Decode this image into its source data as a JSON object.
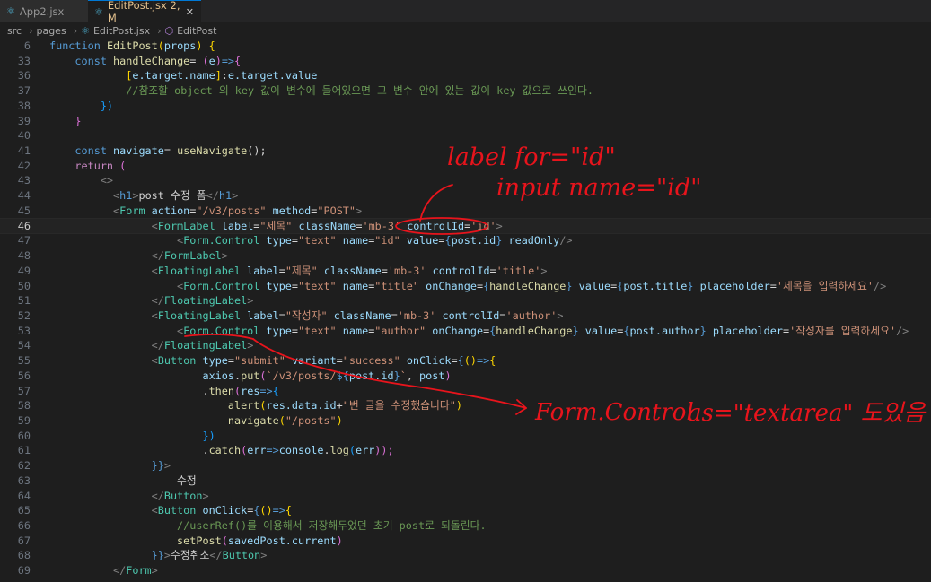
{
  "tabs": [
    {
      "label": "App2.jsx",
      "icon": "react-icon"
    },
    {
      "label": "EditPost.jsx 2, M",
      "icon": "react-icon",
      "active": true
    }
  ],
  "breadcrumb": [
    "src",
    "pages",
    "EditPost.jsx",
    "EditPost"
  ],
  "code_lines": [
    {
      "n": "6"
    },
    {
      "n": "33"
    },
    {
      "n": "36"
    },
    {
      "n": "37"
    },
    {
      "n": "38"
    },
    {
      "n": "39"
    },
    {
      "n": "40"
    },
    {
      "n": "41"
    },
    {
      "n": "42"
    },
    {
      "n": "43"
    },
    {
      "n": "44"
    },
    {
      "n": "45"
    },
    {
      "n": "46"
    },
    {
      "n": "47"
    },
    {
      "n": "48"
    },
    {
      "n": "49"
    },
    {
      "n": "50"
    },
    {
      "n": "51"
    },
    {
      "n": "52"
    },
    {
      "n": "53"
    },
    {
      "n": "54"
    },
    {
      "n": "55"
    },
    {
      "n": "56"
    },
    {
      "n": "57"
    },
    {
      "n": "58"
    },
    {
      "n": "59"
    },
    {
      "n": "60"
    },
    {
      "n": "61"
    },
    {
      "n": "62"
    },
    {
      "n": "63"
    },
    {
      "n": "64"
    },
    {
      "n": "65"
    },
    {
      "n": "66"
    },
    {
      "n": "67"
    },
    {
      "n": "68"
    },
    {
      "n": "69"
    }
  ],
  "code": {
    "l6": [
      "function",
      "EditPost",
      "(",
      "props",
      ")",
      "{"
    ],
    "l33": [
      "const",
      "handleChange",
      "=",
      "(",
      "e",
      ")",
      "=>",
      "{"
    ],
    "l36": [
      "[",
      "e.target.name",
      "]",
      ":",
      "e.target.value"
    ],
    "l37": "//참조할 object 의 key 값이 변수에 들어있으면 그 변수 안에 있는 값이 key 값으로 쓰인다.",
    "l38": "})",
    "l39": "}",
    "l41": [
      "const",
      "navigate",
      "=",
      "useNavigate",
      "();"
    ],
    "l42": [
      "return",
      "("
    ],
    "l43": "<>",
    "l44": [
      "<",
      "h1",
      ">",
      "post 수정 폼",
      "</",
      "h1",
      ">"
    ],
    "l45": [
      "<",
      "Form",
      "action",
      "=",
      "\"/v3/posts\"",
      "method",
      "=",
      "\"POST\"",
      ">"
    ],
    "l46": [
      "<",
      "FormLabel",
      "label",
      "=",
      "\"제목\"",
      "className",
      "=",
      "'mb-3'",
      "controlId",
      "=",
      "'id'",
      ">"
    ],
    "l47": [
      "<",
      "Form.Control",
      "type",
      "=",
      "\"text\"",
      "name",
      "=",
      "\"id\"",
      "value",
      "=",
      "{",
      "post.id",
      "}",
      "readOnly",
      "/>"
    ],
    "l48": [
      "</",
      "FormLabel",
      ">"
    ],
    "l49": [
      "<",
      "FloatingLabel",
      "label",
      "=",
      "\"제목\"",
      "className",
      "=",
      "'mb-3'",
      "controlId",
      "=",
      "'title'",
      ">"
    ],
    "l50": [
      "<",
      "Form.Control",
      "type",
      "=",
      "\"text\"",
      "name",
      "=",
      "\"title\"",
      "onChange",
      "=",
      "{",
      "handleChange",
      "}",
      "value",
      "=",
      "{",
      "post.title",
      "}",
      "placeholder",
      "=",
      "'제목을 입력하세요'",
      "/>"
    ],
    "l51": [
      "</",
      "FloatingLabel",
      ">"
    ],
    "l52": [
      "<",
      "FloatingLabel",
      "label",
      "=",
      "\"작성자\"",
      "className",
      "=",
      "'mb-3'",
      "controlId",
      "=",
      "'author'",
      ">"
    ],
    "l53": [
      "<",
      "Form.Control",
      "type",
      "=",
      "\"text\"",
      "name",
      "=",
      "\"author\"",
      "onChange",
      "=",
      "{",
      "handleChange",
      "}",
      "value",
      "=",
      "{",
      "post.author",
      "}",
      "placeholder",
      "=",
      "'작성자를 입력하세요'",
      "/>"
    ],
    "l54": [
      "</",
      "FloatingLabel",
      ">"
    ],
    "l55": [
      "<",
      "Button",
      "type",
      "=",
      "\"submit\"",
      "variant",
      "=",
      "\"success\"",
      "onClick",
      "=",
      "{",
      "()",
      "=>",
      "{"
    ],
    "l56": [
      "axios",
      ".",
      "put",
      "(",
      "`/v3/posts/",
      "${",
      "post.id",
      "}",
      "`",
      ", ",
      "post",
      ")"
    ],
    "l57": [
      ".",
      "then",
      "(",
      "res",
      "=>",
      "{"
    ],
    "l58": [
      "alert",
      "(",
      "res.data.id",
      "+",
      "\"번 글을 수정했습니다\"",
      ")"
    ],
    "l59": [
      "navigate",
      "(",
      "\"/posts\"",
      ")"
    ],
    "l60": "})",
    "l61": [
      ".",
      "catch",
      "(",
      "err",
      "=>",
      "console",
      ".",
      "log",
      "(",
      "err",
      "));"
    ],
    "l62": [
      "}}",
      ">"
    ],
    "l63": "수정",
    "l64": [
      "</",
      "Button",
      ">"
    ],
    "l65": [
      "<",
      "Button",
      "onClick",
      "=",
      "{",
      "()",
      "=>",
      "{"
    ],
    "l66": "//userRef()를 이용해서 저장해두었던 초기 post로 되돌린다.",
    "l67": [
      "setPost",
      "(",
      "savedPost.current",
      ")"
    ],
    "l68": [
      "}}",
      ">",
      "수정취소",
      "</",
      "Button",
      ">"
    ],
    "l69": [
      "</",
      "Form",
      ">"
    ]
  },
  "annotations": {
    "note1": "label for=\"id\"",
    "note2": "input name=\"id\"",
    "note3": "Form.Control",
    "note4": "as=\"textarea\" 도있음"
  },
  "colors": {
    "annotation": "#e8141c",
    "keyword": "#569cd6",
    "string": "#ce9178",
    "comment": "#6a9955",
    "component": "#4ec9b0"
  }
}
